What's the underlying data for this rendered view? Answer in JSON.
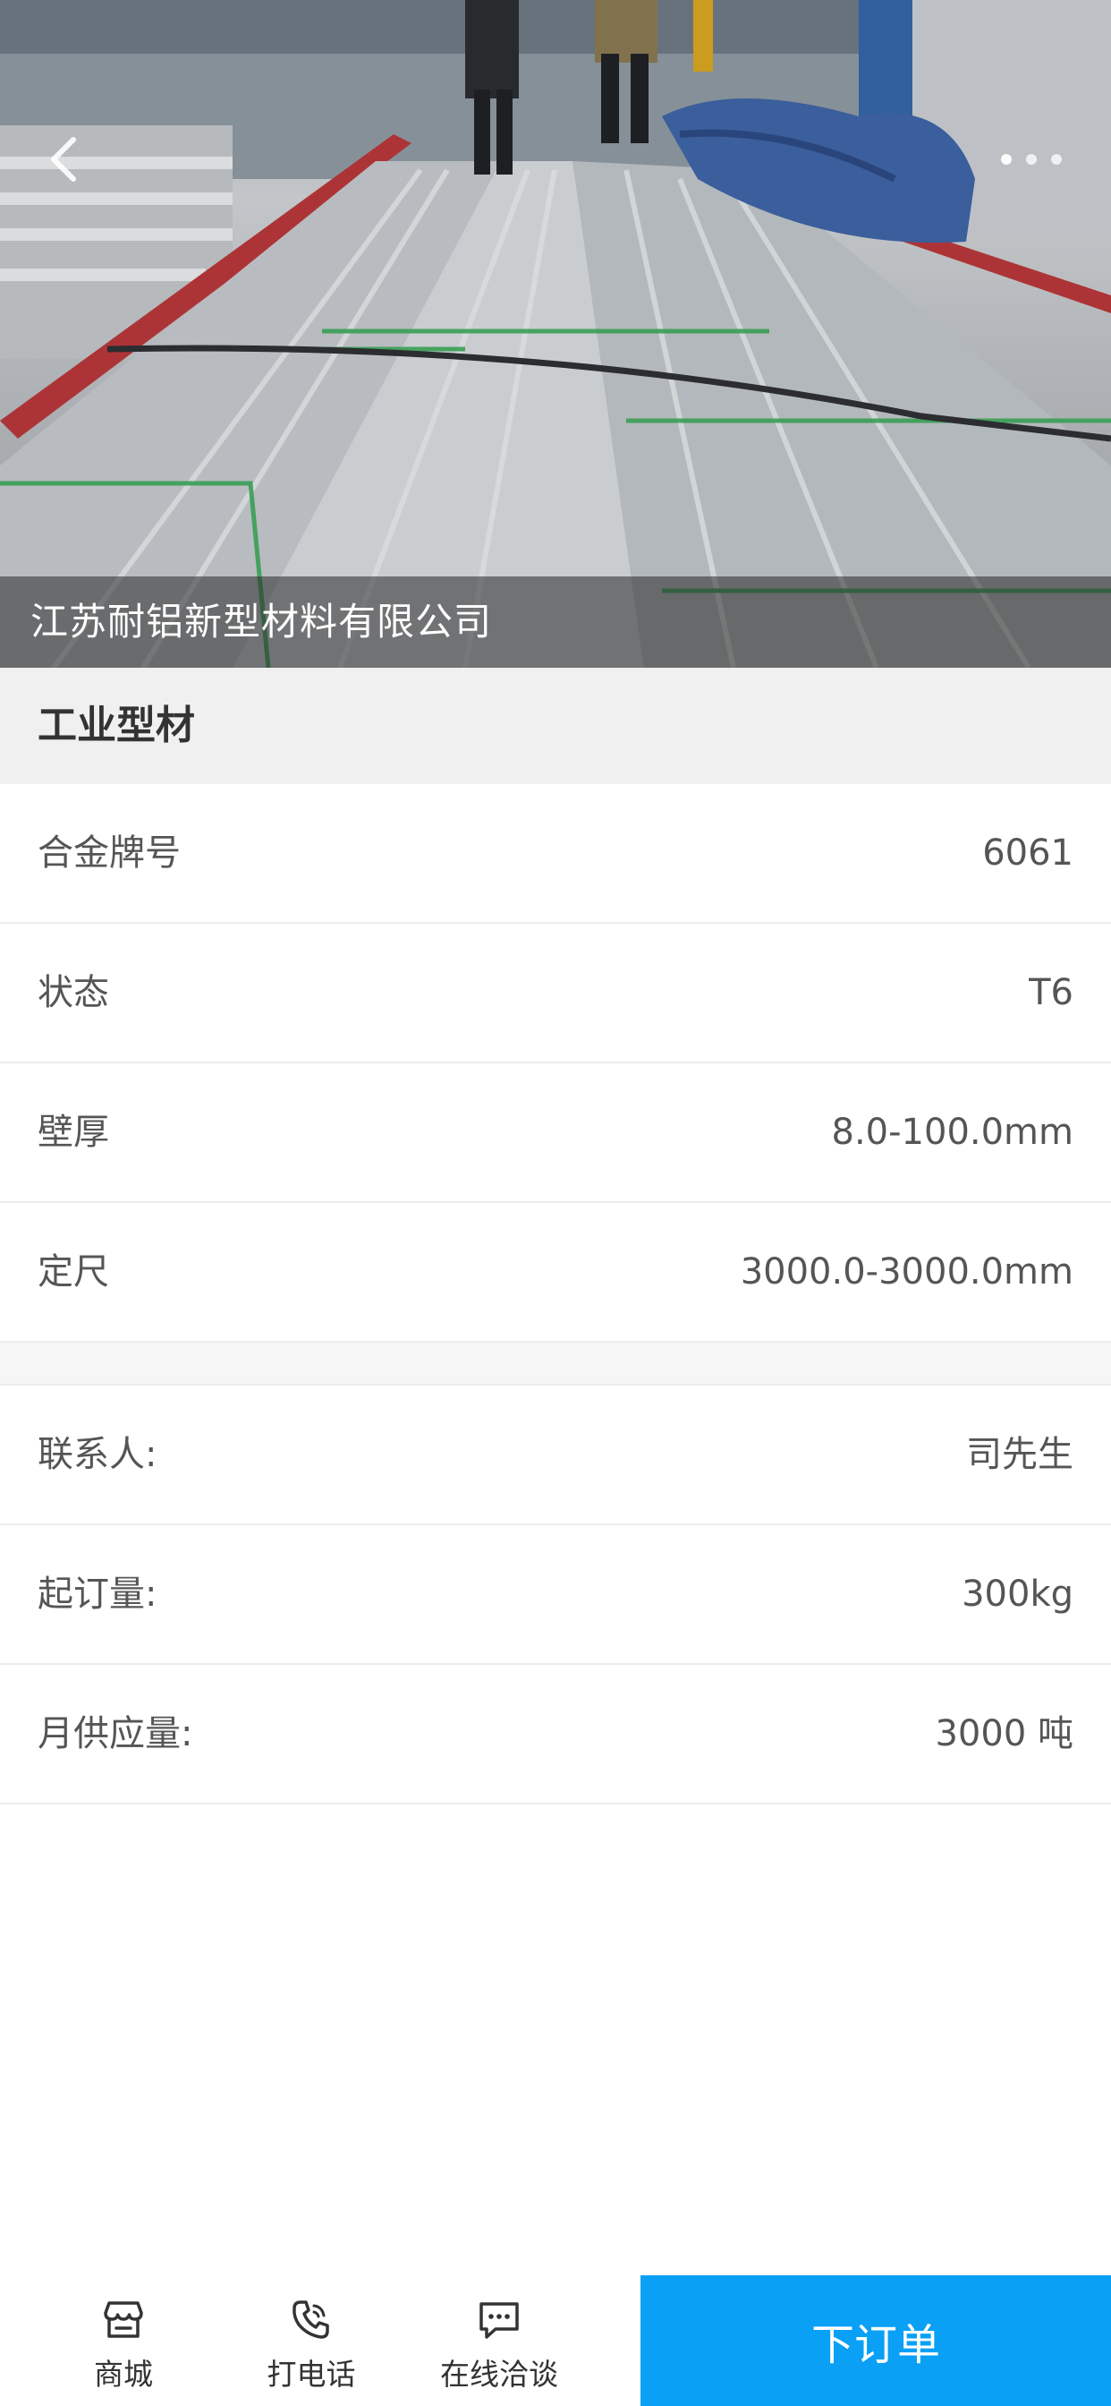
{
  "hero": {
    "caption": "江苏耐铝新型材料有限公司",
    "slide_count": 3
  },
  "product": {
    "title": "工业型材"
  },
  "specs": [
    {
      "label": "合金牌号",
      "value": "6061"
    },
    {
      "label": "状态",
      "value": "T6"
    },
    {
      "label": "壁厚",
      "value": "8.0-100.0mm"
    },
    {
      "label": "定尺",
      "value": "3000.0-3000.0mm"
    }
  ],
  "contact": [
    {
      "label": "联系人:",
      "value": "司先生"
    },
    {
      "label": "起订量:",
      "value": "300kg"
    },
    {
      "label": "月供应量:",
      "value": "3000 吨"
    }
  ],
  "bottom_bar": {
    "mall_label": "商城",
    "call_label": "打电话",
    "chat_label": "在线洽谈",
    "order_label": "下订单"
  },
  "colors": {
    "accent": "#0aa0f5",
    "section_bg": "#f0f0f0",
    "text": "#555555"
  }
}
